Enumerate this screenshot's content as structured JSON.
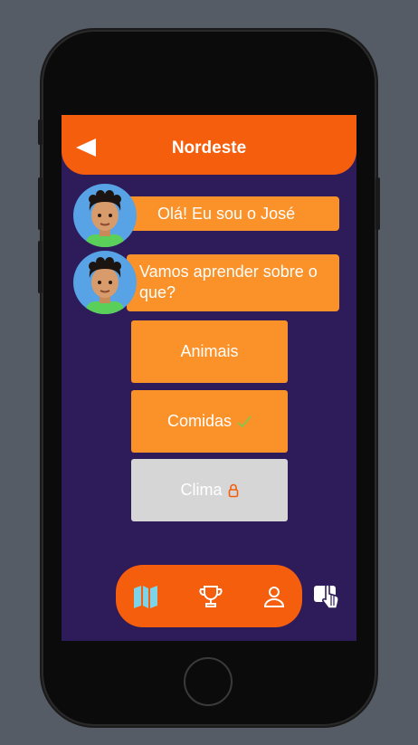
{
  "header": {
    "title": "Nordeste"
  },
  "chat": [
    {
      "text": "Olá! Eu sou o José"
    },
    {
      "text": "Vamos aprender sobre o que?"
    }
  ],
  "options": [
    {
      "label": "Animais",
      "status": "available"
    },
    {
      "label": "Comidas",
      "status": "completed",
      "status_icon": "check-icon"
    },
    {
      "label": "Clima",
      "status": "locked",
      "status_icon": "lock-icon"
    }
  ],
  "nav": {
    "items": [
      {
        "icon": "map-icon",
        "active": true
      },
      {
        "icon": "trophy-icon",
        "active": false
      },
      {
        "icon": "user-icon",
        "active": false
      }
    ]
  },
  "colors": {
    "accent": "#f45e0c",
    "bubble": "#fb9129",
    "background": "#2e1b5a",
    "locked": "#d6d6d6",
    "check": "#8bc34a",
    "active_nav": "#7fd3e6"
  }
}
